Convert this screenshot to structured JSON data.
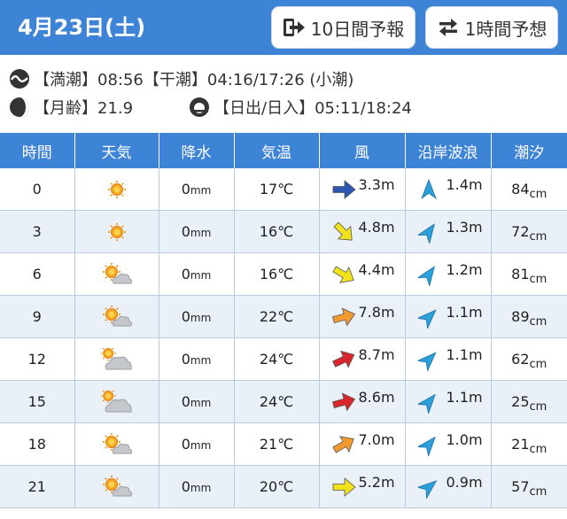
{
  "header": {
    "date": "4月23日(土)",
    "btn_10day": "10日間予報",
    "btn_1hour": "1時間予想"
  },
  "info": {
    "tide_text": "【満潮】08:56【干潮】04:16/17:26 (小潮)",
    "moon_text": "【月齢】21.9",
    "sun_text": "【日出/日入】05:11/18:24"
  },
  "table": {
    "headers": [
      "時間",
      "天気",
      "降水",
      "気温",
      "風",
      "沿岸波浪",
      "潮汐"
    ],
    "precip_unit": "mm",
    "temp_unit": "℃",
    "tide_unit": "cm",
    "rows": [
      {
        "time": "0",
        "weather": "sunny",
        "precip": "0",
        "temp": "17",
        "wind": "3.3m",
        "wind_color": "#2b56b0",
        "wind_rot": 0,
        "wave": "1.4m",
        "wave_rot": 0,
        "tide": "84"
      },
      {
        "time": "3",
        "weather": "sunny",
        "precip": "0",
        "temp": "16",
        "wind": "4.8m",
        "wind_color": "#f2e21b",
        "wind_rot": 45,
        "wave": "1.3m",
        "wave_rot": 35,
        "tide": "72"
      },
      {
        "time": "6",
        "weather": "sunny-cloudy",
        "precip": "0",
        "temp": "16",
        "wind": "4.4m",
        "wind_color": "#f2e21b",
        "wind_rot": 30,
        "wave": "1.2m",
        "wave_rot": 35,
        "tide": "81"
      },
      {
        "time": "9",
        "weather": "sunny-cloudy",
        "precip": "0",
        "temp": "22",
        "wind": "7.8m",
        "wind_color": "#f29a2e",
        "wind_rot": -15,
        "wave": "1.1m",
        "wave_rot": 45,
        "tide": "89"
      },
      {
        "time": "12",
        "weather": "cloudy-sunny",
        "precip": "0",
        "temp": "24",
        "wind": "8.7m",
        "wind_color": "#d9262c",
        "wind_rot": -25,
        "wave": "1.1m",
        "wave_rot": 45,
        "tide": "62"
      },
      {
        "time": "15",
        "weather": "cloudy-sunny",
        "precip": "0",
        "temp": "24",
        "wind": "8.6m",
        "wind_color": "#d9262c",
        "wind_rot": -15,
        "wave": "1.1m",
        "wave_rot": 40,
        "tide": "25"
      },
      {
        "time": "18",
        "weather": "sunny-cloudy",
        "precip": "0",
        "temp": "21",
        "wind": "7.0m",
        "wind_color": "#f29a2e",
        "wind_rot": -30,
        "wave": "1.0m",
        "wave_rot": 40,
        "tide": "21"
      },
      {
        "time": "21",
        "weather": "sunny-cloudy",
        "precip": "0",
        "temp": "20",
        "wind": "5.2m",
        "wind_color": "#f2e21b",
        "wind_rot": 0,
        "wave": "0.9m",
        "wave_rot": 50,
        "tide": "57"
      }
    ]
  },
  "colors": {
    "accent": "#3d83d6",
    "row_alt": "#e9f0f8",
    "border": "#b8ccdf"
  }
}
